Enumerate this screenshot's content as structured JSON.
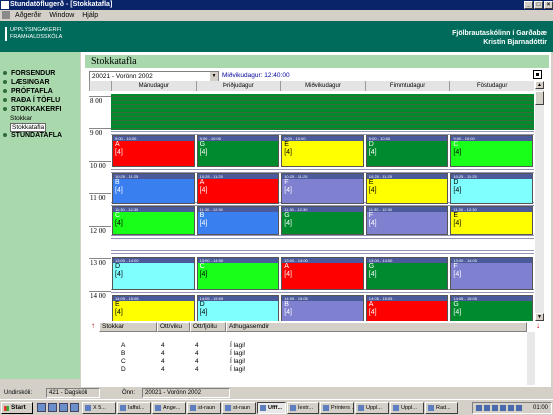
{
  "window": {
    "title": "Stundatöflugerð - [Stokkatafla]"
  },
  "menu": [
    "Aðgerðir",
    "Window",
    "Hjálp"
  ],
  "banner": {
    "logo_line1": "UPPLÝSINGAKERFI",
    "logo_line2": "FRAMHALDSSKÓLA",
    "school": "Fjölbrautaskólinn í Garðabæ",
    "user": "Kristín Bjarnadóttir"
  },
  "nav": {
    "items": [
      "FORSENDUR",
      "LÆSINGAR",
      "PRÓFTAFLA",
      "RAÐA Í TÖFLU",
      "STOKKAKERFI",
      "STUNDATAFLA"
    ],
    "subitems": [
      "Stokkar",
      "Stokkatafla"
    ],
    "selected_subitem": "Stokkatafla"
  },
  "panel": {
    "title": "Stokkatafla",
    "term_select": "20021 - Vorönn 2002",
    "clock": "Miðvikudagur: 12:40:00"
  },
  "days": [
    "Mánudagur",
    "Þriðjudagur",
    "Miðvikudagur",
    "Fimmtudagur",
    "Föstudagur"
  ],
  "hours": [
    "8 00",
    "9 00",
    "10 00",
    "11 00",
    "12 00",
    "13 00",
    "14 00"
  ],
  "colors": {
    "green": "#008a2e",
    "red": "#ff0000",
    "yellow": "#ffff00",
    "cyan": "#80ffff",
    "blue": "#3a7ff0",
    "purple": "#8080d0",
    "bright_green": "#1aff1a",
    "nav_bg": "#a8d8ac",
    "banner_bg": "#006b5b"
  },
  "slots": [
    {
      "time": "9:00 - 10:00",
      "cells": [
        {
          "name": "A",
          "block": "[4]",
          "color": "red"
        },
        {
          "name": "G",
          "block": "[4]",
          "color": "green"
        },
        {
          "name": "E",
          "block": "[4]",
          "color": "yellow"
        },
        {
          "name": "D",
          "block": "[4]",
          "color": "green"
        },
        {
          "name": "C",
          "block": "[4]",
          "color": "bright_green"
        }
      ]
    },
    {
      "time": "10:25 - 11:25",
      "cells": [
        {
          "name": "B",
          "block": "[4]",
          "color": "blue"
        },
        {
          "name": "A",
          "block": "[4]",
          "color": "red"
        },
        {
          "name": "F",
          "block": "[4]",
          "color": "purple"
        },
        {
          "name": "E",
          "block": "[4]",
          "color": "yellow"
        },
        {
          "name": "D",
          "block": "[4]",
          "color": "cyan"
        }
      ]
    },
    {
      "time": "11:30 - 12:30",
      "cells": [
        {
          "name": "C",
          "block": "[4]",
          "color": "bright_green"
        },
        {
          "name": "B",
          "block": "[4]",
          "color": "blue"
        },
        {
          "name": "G",
          "block": "[4]",
          "color": "green"
        },
        {
          "name": "F",
          "block": "[4]",
          "color": "purple"
        },
        {
          "name": "E",
          "block": "[4]",
          "color": "yellow"
        }
      ]
    },
    {
      "time": "13:00 - 14:00",
      "cells": [
        {
          "name": "D",
          "block": "[4]",
          "color": "cyan"
        },
        {
          "name": "C",
          "block": "[4]",
          "color": "bright_green"
        },
        {
          "name": "A",
          "block": "[4]",
          "color": "red"
        },
        {
          "name": "G",
          "block": "[4]",
          "color": "green"
        },
        {
          "name": "F",
          "block": "[4]",
          "color": "purple"
        }
      ]
    },
    {
      "time": "14:05 - 15:05",
      "cells": [
        {
          "name": "E",
          "block": "[4]",
          "color": "yellow"
        },
        {
          "name": "D",
          "block": "[4]",
          "color": "cyan"
        },
        {
          "name": "B",
          "block": "[4]",
          "color": "purple"
        },
        {
          "name": "A",
          "block": "[4]",
          "color": "red"
        },
        {
          "name": "G",
          "block": "[4]",
          "color": "green"
        }
      ]
    }
  ],
  "lower_table": {
    "headers": [
      "Stokkar",
      "Ott/viku",
      "Ott/fjöllu",
      "Athugasemdir"
    ],
    "rows": [
      [
        "A",
        "4",
        "4",
        "Í lagi!"
      ],
      [
        "B",
        "4",
        "4",
        "Í lagi!"
      ],
      [
        "C",
        "4",
        "4",
        "Í lagi!"
      ],
      [
        "D",
        "4",
        "4",
        "Í lagi!"
      ]
    ]
  },
  "status": {
    "label1": "Undirskóli:",
    "value1": "421 - Dagskóli",
    "label2": "Önn:",
    "value2": "20021 - Vorönn 2002"
  },
  "taskbar": {
    "start": "Start",
    "tasks": [
      "X 5...",
      "Iaffal...",
      "Ange...",
      "st-raun",
      "st-raun",
      "Ufff...",
      "Íextr...",
      "Printers ...",
      "Uppl...",
      "Uppl...",
      "Rad..."
    ],
    "time": "01:00"
  }
}
